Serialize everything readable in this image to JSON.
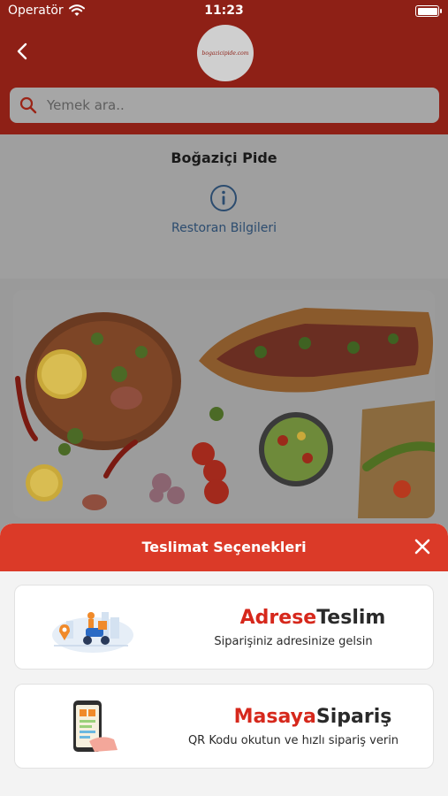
{
  "status_bar": {
    "carrier": "Operatör",
    "time": "11:23"
  },
  "header": {
    "logo_text": "bogazicipide.com",
    "search_placeholder": "Yemek ara.."
  },
  "restaurant": {
    "name": "Boğaziçi Pide",
    "info_label": "Restoran Bilgileri"
  },
  "sheet": {
    "title": "Teslimat Seçenekleri",
    "options": [
      {
        "title_accent": "Adrese",
        "title_main": "Teslim",
        "subtitle": "Siparişiniz adresinize gelsin",
        "icon": "delivery-scooter-icon"
      },
      {
        "title_accent": "Masaya",
        "title_main": "Sipariş",
        "subtitle": "QR Kodu okutun ve hızlı sipariş verin",
        "icon": "qr-phone-icon"
      }
    ]
  },
  "colors": {
    "header_bg": "#8e2016",
    "sheet_header": "#db3a28",
    "accent_red": "#d6281c",
    "info_blue": "#2c4c6f"
  }
}
